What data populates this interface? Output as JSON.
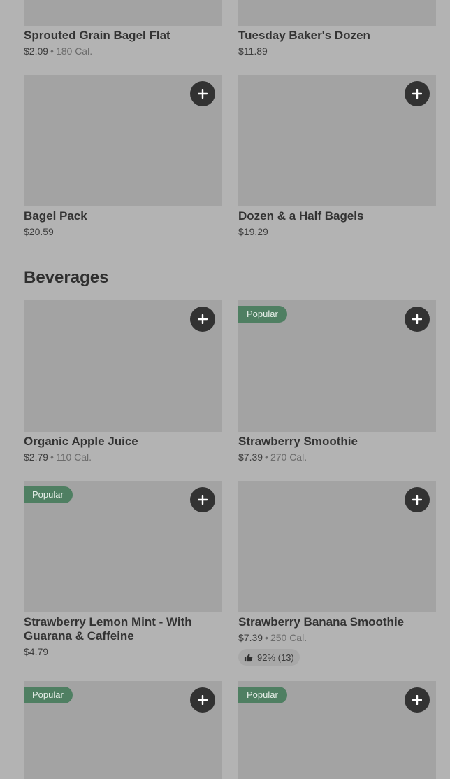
{
  "colors": {
    "page_background": "#b3b3b3",
    "image_placeholder": "#a3a3a3",
    "add_button": "#323232",
    "popular_badge": "#4f7f62"
  },
  "icons": {
    "add": "plus-icon",
    "rating": "thumbs-up-icon"
  },
  "top_items": [
    {
      "name": "Sprouted Grain Bagel Flat",
      "price": "$2.09",
      "separator": "•",
      "calories": "180 Cal."
    },
    {
      "name": "Tuesday Baker's Dozen",
      "price": "$11.89"
    },
    {
      "name": "Bagel Pack",
      "price": "$20.59"
    },
    {
      "name": "Dozen & a Half Bagels",
      "price": "$19.29"
    }
  ],
  "beverages": {
    "title": "Beverages",
    "items": [
      {
        "name": "Organic Apple Juice",
        "price": "$2.79",
        "separator": "•",
        "calories": "110 Cal."
      },
      {
        "badge": "Popular",
        "name": "Strawberry Smoothie",
        "price": "$7.39",
        "separator": "•",
        "calories": "270 Cal."
      },
      {
        "badge": "Popular",
        "name": "Strawberry Lemon Mint - With Guarana & Caffeine",
        "price": "$4.79"
      },
      {
        "name": "Strawberry Banana Smoothie",
        "price": "$7.39",
        "separator": "•",
        "calories": "250 Cal.",
        "rating": "92% (13)"
      },
      {
        "badge": "Popular"
      },
      {
        "badge": "Popular"
      }
    ]
  }
}
